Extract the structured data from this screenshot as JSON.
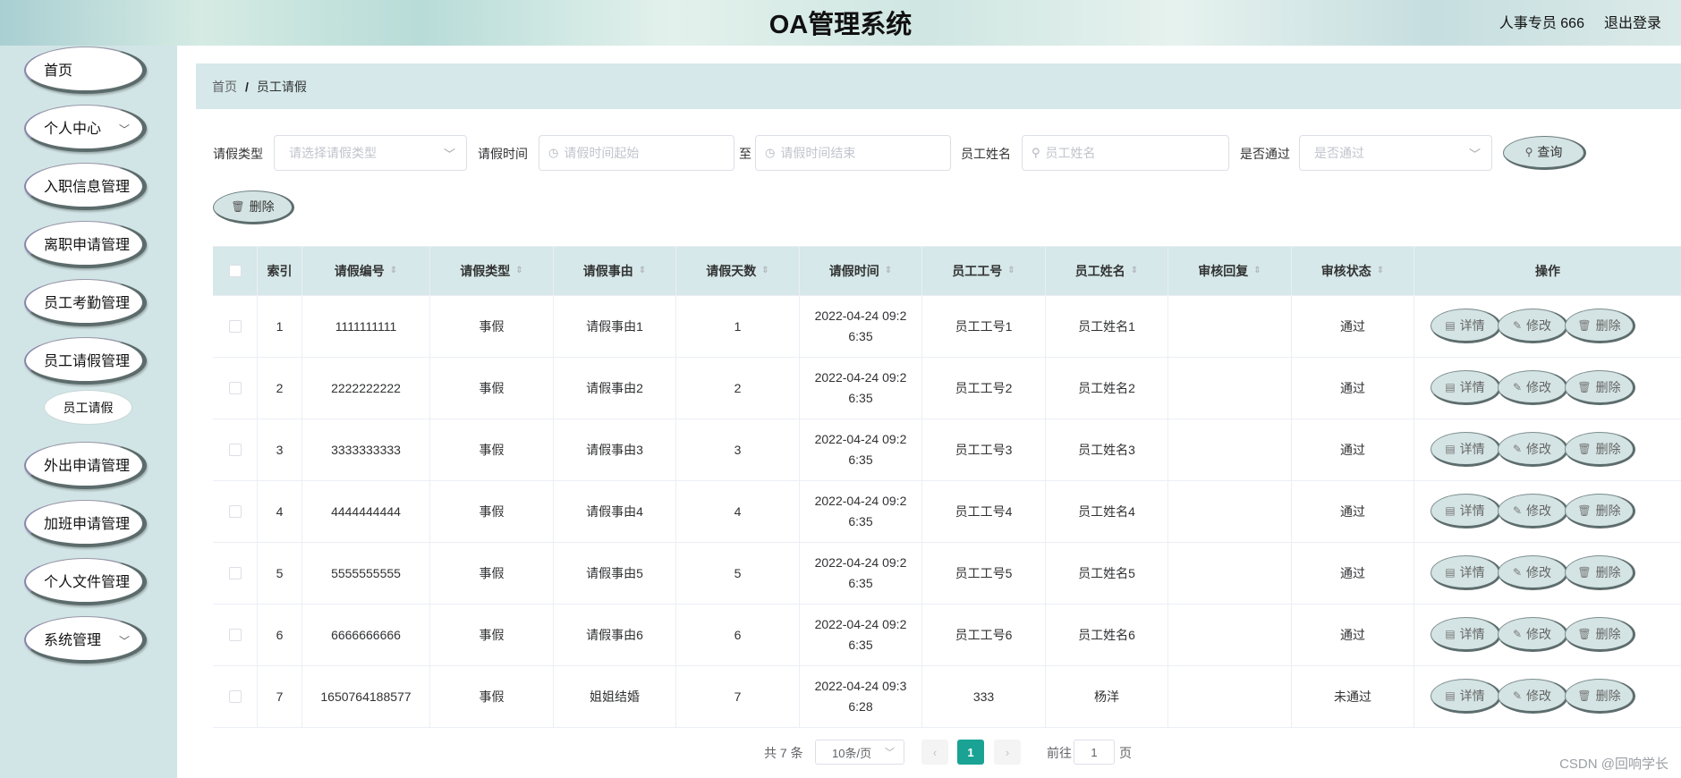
{
  "header": {
    "title": "OA管理系统",
    "user": "人事专员 666",
    "logout": "退出登录"
  },
  "sidebar": {
    "items": [
      {
        "label": "首页",
        "chevron": false
      },
      {
        "label": "个人中心",
        "chevron": true
      },
      {
        "label": "入职信息管理",
        "chevron": false
      },
      {
        "label": "离职申请管理",
        "chevron": false
      },
      {
        "label": "员工考勤管理",
        "chevron": false
      },
      {
        "label": "员工请假管理",
        "chevron": false
      },
      {
        "label": "外出申请管理",
        "chevron": false
      },
      {
        "label": "加班申请管理",
        "chevron": false
      },
      {
        "label": "个人文件管理",
        "chevron": false
      },
      {
        "label": "系统管理",
        "chevron": true
      }
    ],
    "sub_item": "员工请假"
  },
  "breadcrumb": {
    "home": "首页",
    "sep": "/",
    "current": "员工请假"
  },
  "search": {
    "type_label": "请假类型",
    "type_placeholder": "请选择请假类型",
    "time_label": "请假时间",
    "time_start_placeholder": "请假时间起始",
    "time_to": "至",
    "time_end_placeholder": "请假时间结束",
    "name_label": "员工姓名",
    "name_placeholder": "员工姓名",
    "pass_label": "是否通过",
    "pass_placeholder": "是否通过",
    "query_button": "查询",
    "delete_button": "删除"
  },
  "table": {
    "headers": [
      "索引",
      "请假编号",
      "请假类型",
      "请假事由",
      "请假天数",
      "请假时间",
      "员工工号",
      "员工姓名",
      "审核回复",
      "审核状态",
      "操作"
    ],
    "rows": [
      {
        "index": "1",
        "code": "1111111111",
        "type": "事假",
        "reason": "请假事由1",
        "days": "1",
        "time_a": "2022-04-24 09:2",
        "time_b": "6:35",
        "emp_no": "员工工号1",
        "emp_name": "员工姓名1",
        "reply": "",
        "status": "通过"
      },
      {
        "index": "2",
        "code": "2222222222",
        "type": "事假",
        "reason": "请假事由2",
        "days": "2",
        "time_a": "2022-04-24 09:2",
        "time_b": "6:35",
        "emp_no": "员工工号2",
        "emp_name": "员工姓名2",
        "reply": "",
        "status": "通过"
      },
      {
        "index": "3",
        "code": "3333333333",
        "type": "事假",
        "reason": "请假事由3",
        "days": "3",
        "time_a": "2022-04-24 09:2",
        "time_b": "6:35",
        "emp_no": "员工工号3",
        "emp_name": "员工姓名3",
        "reply": "",
        "status": "通过"
      },
      {
        "index": "4",
        "code": "4444444444",
        "type": "事假",
        "reason": "请假事由4",
        "days": "4",
        "time_a": "2022-04-24 09:2",
        "time_b": "6:35",
        "emp_no": "员工工号4",
        "emp_name": "员工姓名4",
        "reply": "",
        "status": "通过"
      },
      {
        "index": "5",
        "code": "5555555555",
        "type": "事假",
        "reason": "请假事由5",
        "days": "5",
        "time_a": "2022-04-24 09:2",
        "time_b": "6:35",
        "emp_no": "员工工号5",
        "emp_name": "员工姓名5",
        "reply": "",
        "status": "通过"
      },
      {
        "index": "6",
        "code": "6666666666",
        "type": "事假",
        "reason": "请假事由6",
        "days": "6",
        "time_a": "2022-04-24 09:2",
        "time_b": "6:35",
        "emp_no": "员工工号6",
        "emp_name": "员工姓名6",
        "reply": "",
        "status": "通过"
      },
      {
        "index": "7",
        "code": "1650764188577",
        "type": "事假",
        "reason": "姐姐结婚",
        "days": "7",
        "time_a": "2022-04-24 09:3",
        "time_b": "6:28",
        "emp_no": "333",
        "emp_name": "杨洋",
        "reply": "",
        "status": "未通过"
      }
    ],
    "actions": {
      "detail": "详情",
      "edit": "修改",
      "delete": "删除"
    }
  },
  "pagination": {
    "total": "共 7 条",
    "page_size": "10条/页",
    "current_page": "1",
    "prev": "‹",
    "next": "›",
    "goto_label": "前往",
    "goto_value": "1",
    "goto_unit": "页"
  },
  "watermark": "CSDN @回响学长",
  "colors": {
    "sidebar_bg": "#d2e5e6",
    "header_row_bg": "#d6e8e9",
    "active_page": "#1aa394"
  }
}
